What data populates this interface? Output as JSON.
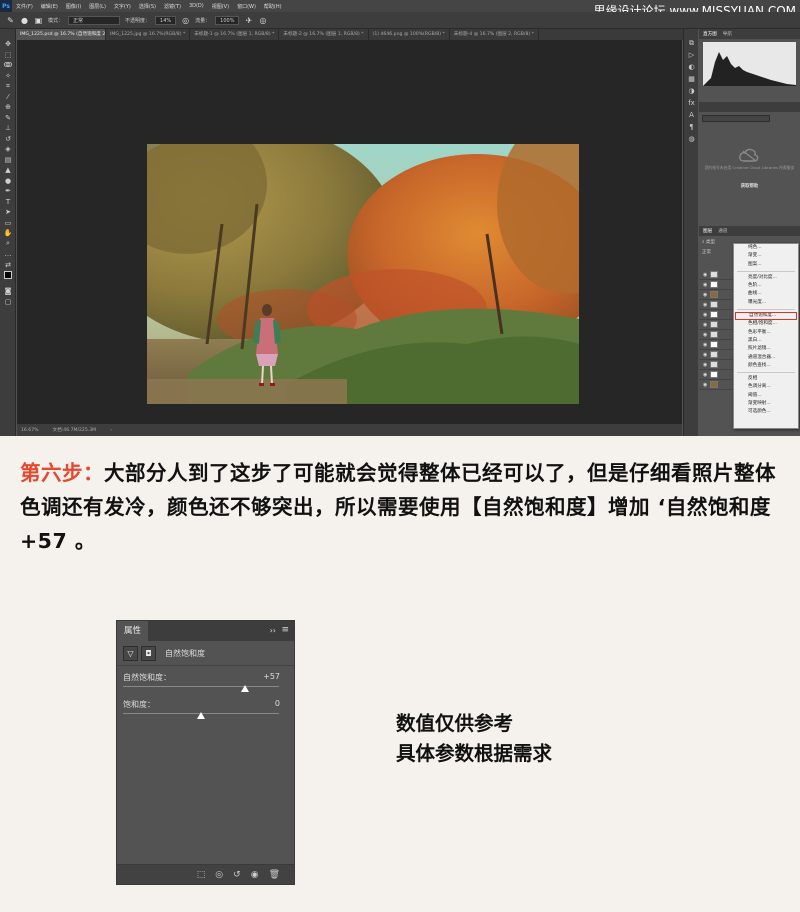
{
  "menubar": {
    "logo": "Ps",
    "items": [
      "文件(F)",
      "编辑(E)",
      "图像(I)",
      "图层(L)",
      "文字(Y)",
      "选择(S)",
      "滤镜(T)",
      "3D(D)",
      "视图(V)",
      "窗口(W)",
      "帮助(H)"
    ],
    "watermark": "思缘设计论坛  www.MISSYUAN.COM"
  },
  "options_bar": {
    "mode_label": "模式：",
    "mode_value": "正常",
    "opacity_label": "不透明度：",
    "opacity_value": "14%",
    "flow_label": "流量：",
    "flow_value": "100%"
  },
  "doc_tabs": [
    {
      "label": "IMG_1225.psd @ 16.7% (自然饱和度 2, 图层蒙版/8) *",
      "active": true
    },
    {
      "label": "IMG_1225.jpg @ 16.7%(RGB/8) *",
      "active": false
    },
    {
      "label": "未标题-1 @ 16.7% (图层 1, RGB/8) *",
      "active": false
    },
    {
      "label": "未标题-2 @ 16.7% (图层 1, RGB/8) *",
      "active": false
    },
    {
      "label": "(1) 4646.png @ 100%(RGB/8) *",
      "active": false
    },
    {
      "label": "未标题-4 @ 16.7% (图层 2, RGB/8) *",
      "active": false
    }
  ],
  "status_bar": {
    "zoom": "16.67%",
    "doc_info": "文档:46.7M/225.3M"
  },
  "panels": {
    "histogram_tabs": [
      "直方图",
      "导航"
    ],
    "library_message": "您的帐号未启用 Creative Cloud Libraries 所需服务",
    "library_link": "获取帮助",
    "layers_tabs": [
      "图层",
      "通道"
    ],
    "layers_kind": "类型",
    "layers_blend": "正常"
  },
  "adjustment_menu": {
    "items": [
      "纯色...",
      "渐变...",
      "图案...",
      "-",
      "亮度/对比度...",
      "色阶...",
      "曲线...",
      "曝光度...",
      "-",
      "自然饱和度...",
      "色相/饱和度...",
      "色彩平衡...",
      "黑白...",
      "照片滤镜...",
      "通道混合器...",
      "颜色查找...",
      "-",
      "反相",
      "色调分离...",
      "阈值...",
      "渐变映射...",
      "可选颜色..."
    ],
    "highlighted": "自然饱和度..."
  },
  "step": {
    "label": "第六步：",
    "text": "大部分人到了这步了可能就会觉得整体已经可以了，但是仔细看照片整体色调还有发冷，颜色还不够突出，所以需要使用【自然饱和度】增加 ‘自然饱和度+57 。"
  },
  "properties_panel": {
    "tab": "属性",
    "title": "自然饱和度",
    "sliders": [
      {
        "label": "自然饱和度：",
        "value": "+57",
        "level": 0.785
      },
      {
        "label": "饱和度：",
        "value": "0",
        "level": 0.5
      }
    ]
  },
  "note": {
    "line1": "数值仅供参考",
    "line2": "具体参数根据需求"
  },
  "colors": {
    "step_label": "#e6492e",
    "menu_highlight": "#e0312b",
    "ps_dark": "#3d3d3d",
    "ps_canvas": "#262626"
  }
}
